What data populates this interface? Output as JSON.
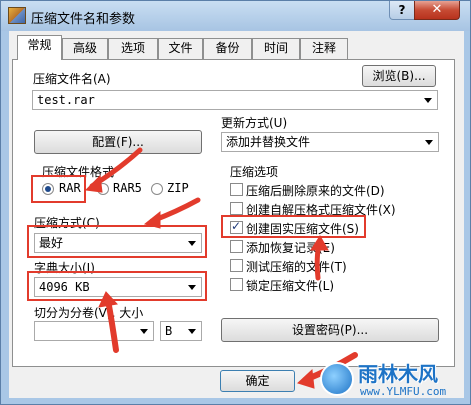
{
  "window": {
    "title": "压缩文件名和参数",
    "help": "?",
    "close": "✕"
  },
  "tabs": [
    "常规",
    "高级",
    "选项",
    "文件",
    "备份",
    "时间",
    "注释"
  ],
  "archive_name": {
    "label": "压缩文件名(A)",
    "value": "test.rar",
    "browse_label": "浏览(B)..."
  },
  "update_mode": {
    "label": "更新方式(U)",
    "value": "添加并替换文件"
  },
  "profile_button": "配置(F)...",
  "format": {
    "label": "压缩文件格式",
    "options": [
      "RAR",
      "RAR5",
      "ZIP"
    ],
    "selected": "RAR"
  },
  "method": {
    "label": "压缩方式(C)",
    "value": "最好"
  },
  "dictionary": {
    "label": "字典大小(I)",
    "value": "4096 KB"
  },
  "split": {
    "label": "切分为分卷(V), 大小",
    "unit": "B"
  },
  "options": {
    "label": "压缩选项",
    "items": [
      {
        "label": "压缩后删除原来的文件(D)",
        "checked": false
      },
      {
        "label": "创建自解压格式压缩文件(X)",
        "checked": false
      },
      {
        "label": "创建固实压缩文件(S)",
        "checked": true
      },
      {
        "label": "添加恢复记录(E)",
        "checked": false
      },
      {
        "label": "测试压缩的文件(T)",
        "checked": false
      },
      {
        "label": "锁定压缩文件(L)",
        "checked": false
      }
    ]
  },
  "password_button": "设置密码(P)...",
  "ok_button": "确定",
  "watermark": {
    "text": "雨林木风",
    "url": "www.YLMFU.com"
  },
  "colors": {
    "annotation": "#e23b2c",
    "watermark": "#1d73c6"
  }
}
